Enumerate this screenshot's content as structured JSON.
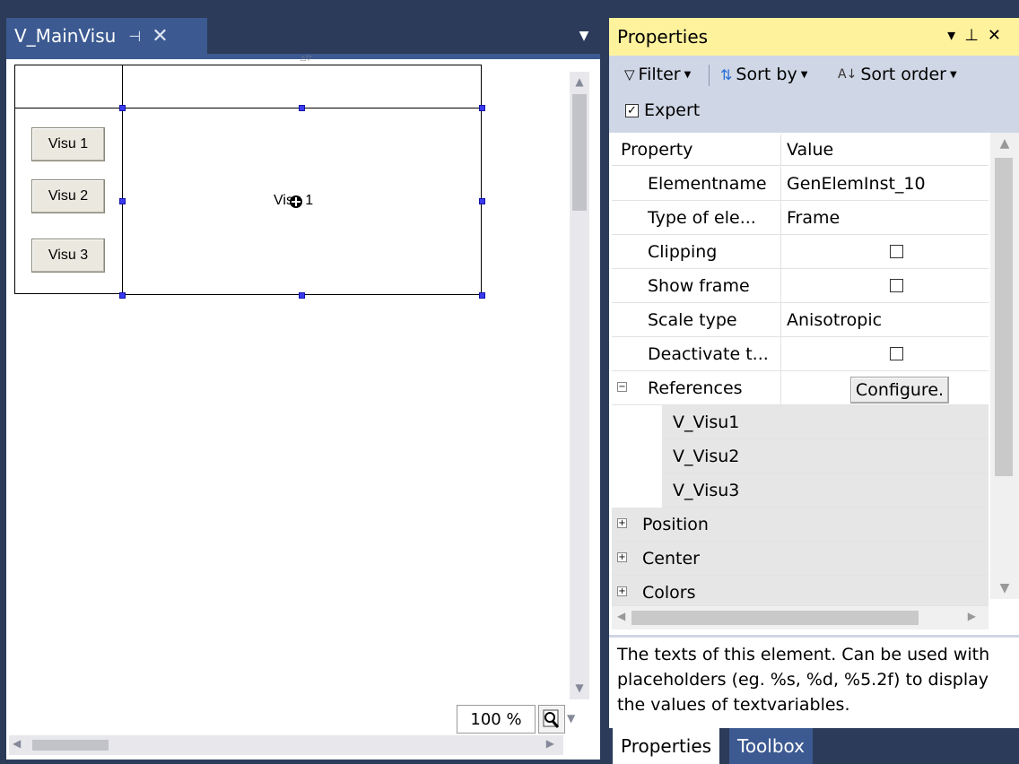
{
  "editor": {
    "tab_title": "V_MainVisu",
    "pin_icon": "pin-icon",
    "close_icon": "close-icon",
    "buttons": [
      "Visu 1",
      "Visu 2",
      "Visu 3"
    ],
    "frame_label": "Visu 1",
    "zoom": "100 %"
  },
  "properties": {
    "title": "Properties",
    "toolbar": {
      "filter": "Filter",
      "sort_by": "Sort by",
      "sort_order": "Sort order",
      "expert": "Expert",
      "expert_checked": true
    },
    "columns": {
      "property": "Property",
      "value": "Value"
    },
    "rows": [
      {
        "name": "Elementname",
        "value": "GenElemInst_10"
      },
      {
        "name": "Type of ele...",
        "value": "Frame"
      },
      {
        "name": "Clipping",
        "checked": false
      },
      {
        "name": "Show frame",
        "checked": false
      },
      {
        "name": "Scale type",
        "value": "Anisotropic"
      },
      {
        "name": "Deactivate t...",
        "checked": false
      }
    ],
    "references": {
      "name": "References",
      "button": "Configure.",
      "items": [
        "V_Visu1",
        "V_Visu2",
        "V_Visu3"
      ]
    },
    "groups": [
      "Position",
      "Center",
      "Colors"
    ],
    "description": "The texts of this element. Can be used with placeholders (eg. %s, %d, %5.2f) to display the values of textvariables.",
    "bottom_tabs": [
      "Properties",
      "Toolbox"
    ]
  },
  "colors": {
    "accent_blue": "#3c5a91",
    "dark_bg": "#2b3b59",
    "properties_title_bg": "#fff29d",
    "selection_handle": "#3a3af0"
  }
}
